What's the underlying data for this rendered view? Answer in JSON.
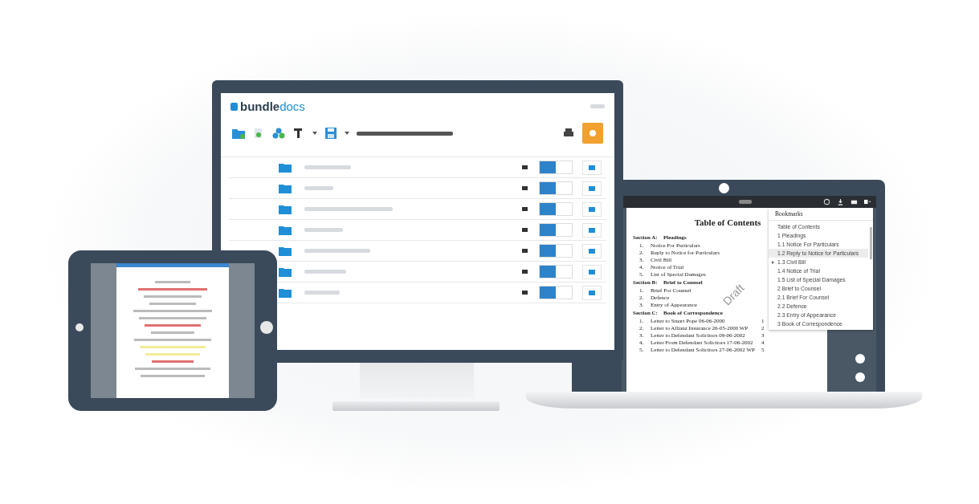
{
  "desktop_app": {
    "logo": {
      "part1": "bundle",
      "part2": "docs"
    },
    "rows": [
      {
        "toggle_on": true
      },
      {
        "toggle_on": true
      },
      {
        "toggle_on": true
      },
      {
        "toggle_on": true
      },
      {
        "toggle_on": true
      },
      {
        "toggle_on": true
      },
      {
        "toggle_on": true
      }
    ]
  },
  "laptop_viewer": {
    "document": {
      "title": "Table of Contents",
      "stamp": "Draft",
      "sections": [
        {
          "heading": "Section A:",
          "name": "Pleadings",
          "entries": [
            {
              "number": "1.",
              "title": "Notice For Particulars"
            },
            {
              "number": "2.",
              "title": "Reply to Notice for Particulars"
            },
            {
              "number": "3.",
              "title": "Civil Bill"
            },
            {
              "number": "4.",
              "title": "Notice of Trial"
            },
            {
              "number": "5.",
              "title": "List of Special Damages"
            }
          ]
        },
        {
          "heading": "Section B:",
          "name": "Brief to Counsel",
          "entries": [
            {
              "number": "1.",
              "title": "Brief For Counsel"
            },
            {
              "number": "2.",
              "title": "Defence"
            },
            {
              "number": "3.",
              "title": "Entry of Appearance"
            }
          ]
        },
        {
          "heading": "Section C:",
          "name": "Book of Correspondence",
          "entries": [
            {
              "number": "1.",
              "title": "Letter to Stuart Pope 06-06-2000",
              "page": "1"
            },
            {
              "number": "2.",
              "title": "Letter to Allianz Insurance 26-05-2000 WP",
              "page": "2"
            },
            {
              "number": "3.",
              "title": "Letter to Defendant Solicitors 09-06-2002",
              "page": "3"
            },
            {
              "number": "4.",
              "title": "Letter From Defendant Solicitors 17-06-2002",
              "page": "4"
            },
            {
              "number": "5.",
              "title": "Letter to Defendant Solicitors 27-06-2002 WP",
              "page": "5"
            }
          ]
        }
      ]
    },
    "bookmarks": {
      "title": "Bookmarks",
      "items": [
        {
          "label": "Table of Contents",
          "selected": false,
          "has_children": false
        },
        {
          "label": "1 Pleadings",
          "selected": false,
          "has_children": false
        },
        {
          "label": "1.1 Notice For Particulars",
          "selected": false,
          "has_children": false
        },
        {
          "label": "1.2 Reply to Notice for Particulars",
          "selected": true,
          "has_children": false
        },
        {
          "label": "1.3 Civil Bill",
          "selected": false,
          "has_children": true
        },
        {
          "label": "1.4 Notice of Trial",
          "selected": false,
          "has_children": false
        },
        {
          "label": "1.5 List of Special Damages",
          "selected": false,
          "has_children": false
        },
        {
          "label": "2 Brief to Counsel",
          "selected": false,
          "has_children": false
        },
        {
          "label": "2.1 Brief For Counsel",
          "selected": false,
          "has_children": false
        },
        {
          "label": "2.2 Defence",
          "selected": false,
          "has_children": false
        },
        {
          "label": "2.3 Entry of Appearance",
          "selected": false,
          "has_children": false
        },
        {
          "label": "3 Book of Correspondence",
          "selected": false,
          "has_children": false
        }
      ]
    }
  }
}
